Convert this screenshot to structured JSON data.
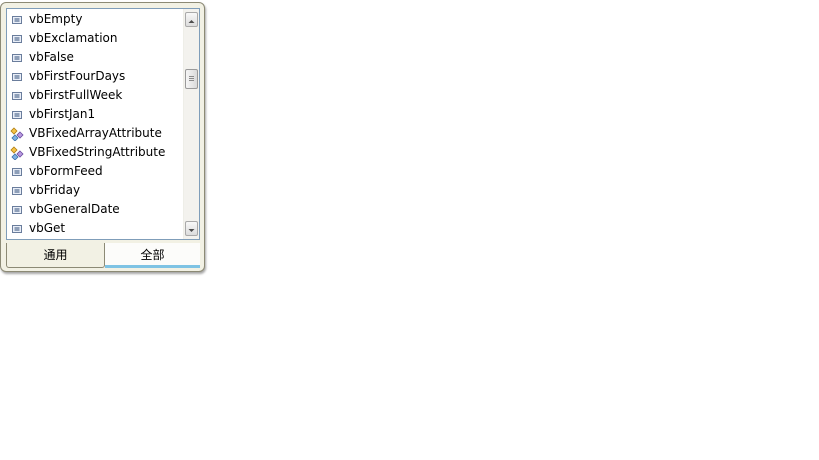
{
  "list": {
    "items": [
      {
        "label": "vbEmpty",
        "icon": "constant-icon"
      },
      {
        "label": "vbExclamation",
        "icon": "constant-icon"
      },
      {
        "label": "vbFalse",
        "icon": "constant-icon"
      },
      {
        "label": "vbFirstFourDays",
        "icon": "constant-icon"
      },
      {
        "label": "vbFirstFullWeek",
        "icon": "constant-icon"
      },
      {
        "label": "vbFirstJan1",
        "icon": "constant-icon"
      },
      {
        "label": "VBFixedArrayAttribute",
        "icon": "class-icon"
      },
      {
        "label": "VBFixedStringAttribute",
        "icon": "class-icon"
      },
      {
        "label": "vbFormFeed",
        "icon": "constant-icon"
      },
      {
        "label": "vbFriday",
        "icon": "constant-icon"
      },
      {
        "label": "vbGeneralDate",
        "icon": "constant-icon"
      },
      {
        "label": "vbGet",
        "icon": "constant-icon"
      }
    ]
  },
  "tabs": {
    "common_label": "通用",
    "all_label": "全部",
    "selected": "all_label"
  },
  "colors": {
    "selected_tab_underline": "#7ec3e4",
    "list_border": "#7f9db9"
  }
}
